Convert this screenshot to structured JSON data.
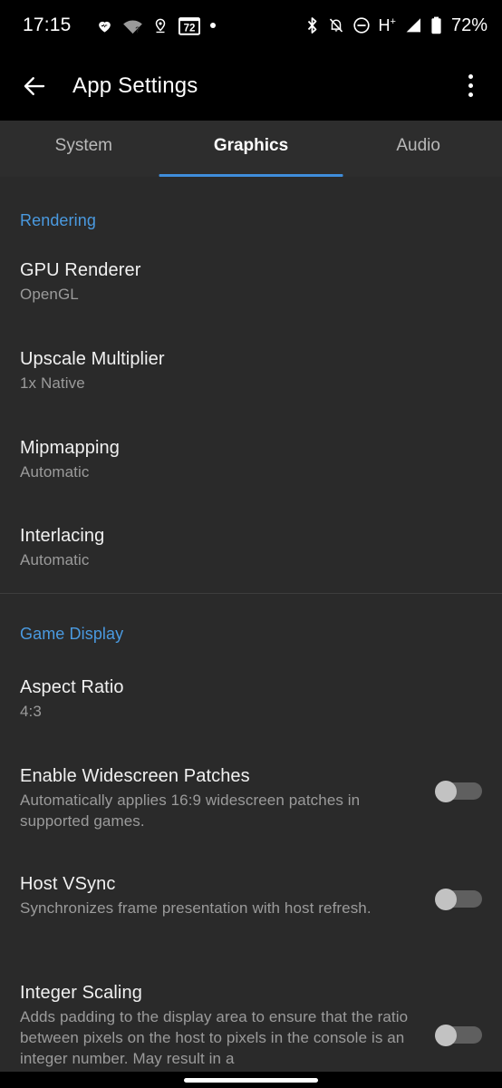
{
  "status_bar": {
    "clock": "17:15",
    "battery_percent": "72%",
    "network_type": "H",
    "network_superscript": "+",
    "calendar_badge": "72",
    "left_icons": [
      "heart-icon",
      "wifi-question-icon",
      "location-pin-icon",
      "calendar-72-icon",
      "dot-icon"
    ],
    "right_icons": [
      "bluetooth-icon",
      "notifications-muted-icon",
      "do-not-disturb-icon",
      "network-hplus-icon",
      "signal-bars-icon",
      "battery-icon"
    ]
  },
  "toolbar": {
    "back_icon": "arrow-left-icon",
    "title": "App Settings",
    "overflow_icon": "more-vertical-icon"
  },
  "tabs": [
    {
      "label": "System",
      "active": false
    },
    {
      "label": "Graphics",
      "active": true
    },
    {
      "label": "Audio",
      "active": false
    }
  ],
  "accent_color": "#4a9ae0",
  "indicator_color": "#3f8ddb",
  "sections": [
    {
      "header": "Rendering",
      "items": [
        {
          "title": "GPU Renderer",
          "subtitle": "OpenGL"
        },
        {
          "title": "Upscale Multiplier",
          "subtitle": "1x Native"
        },
        {
          "title": "Mipmapping",
          "subtitle": "Automatic"
        },
        {
          "title": "Interlacing",
          "subtitle": "Automatic"
        }
      ]
    },
    {
      "header": "Game Display",
      "items": [
        {
          "title": "Aspect Ratio",
          "subtitle": "4:3"
        },
        {
          "title": "Enable Widescreen Patches",
          "subtitle": "Automatically applies 16:9 widescreen patches in supported games.",
          "switch": "off"
        },
        {
          "title": "Host VSync",
          "subtitle": "Synchronizes frame presentation with host refresh.",
          "switch": "off"
        },
        {
          "title": "Integer Scaling",
          "subtitle": "Adds padding to the display area to ensure that the ratio between pixels on the host to pixels in the console is an integer number. May result in a",
          "switch": "off"
        }
      ]
    }
  ],
  "navigation": {
    "gesture_pill": "home-gesture-pill"
  }
}
